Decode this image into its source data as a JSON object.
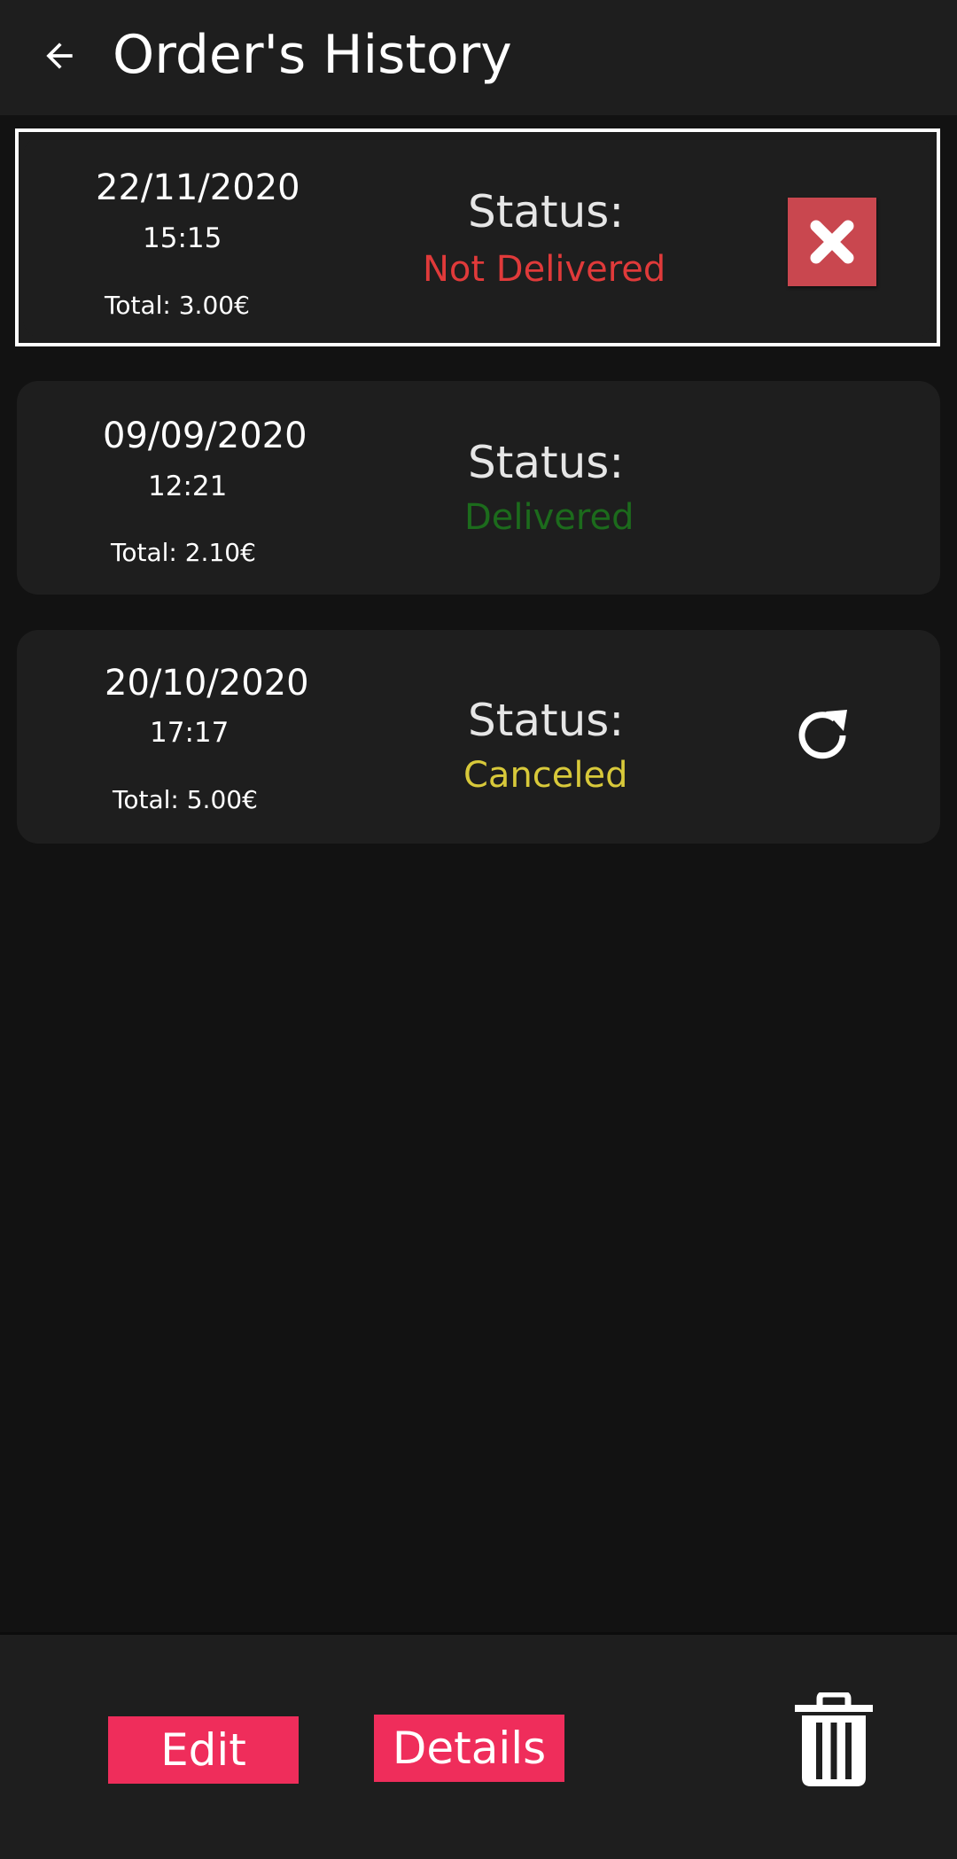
{
  "header": {
    "title": "Order's History",
    "back_icon": "arrow-left-icon"
  },
  "status_label": "Status:",
  "colors": {
    "not_delivered": "#e03a3a",
    "delivered": "#1c6b1c",
    "canceled": "#d8c93a",
    "accent": "#ef2d5b",
    "cancel_button": "#c9474f"
  },
  "orders": [
    {
      "date": "22/11/2020",
      "time": "15:15",
      "total": "Total: 3.00€",
      "status": "Not Delivered",
      "action_icon": "close-icon",
      "selected": true
    },
    {
      "date": "09/09/2020",
      "time": "12:21",
      "total": "Total: 2.10€",
      "status": "Delivered",
      "action_icon": "",
      "selected": false
    },
    {
      "date": "20/10/2020",
      "time": "17:17",
      "total": "Total: 5.00€",
      "status": "Canceled",
      "action_icon": "refresh-icon",
      "selected": false
    }
  ],
  "bottom_bar": {
    "edit_label": "Edit",
    "details_label": "Details",
    "delete_icon": "trash-icon"
  }
}
